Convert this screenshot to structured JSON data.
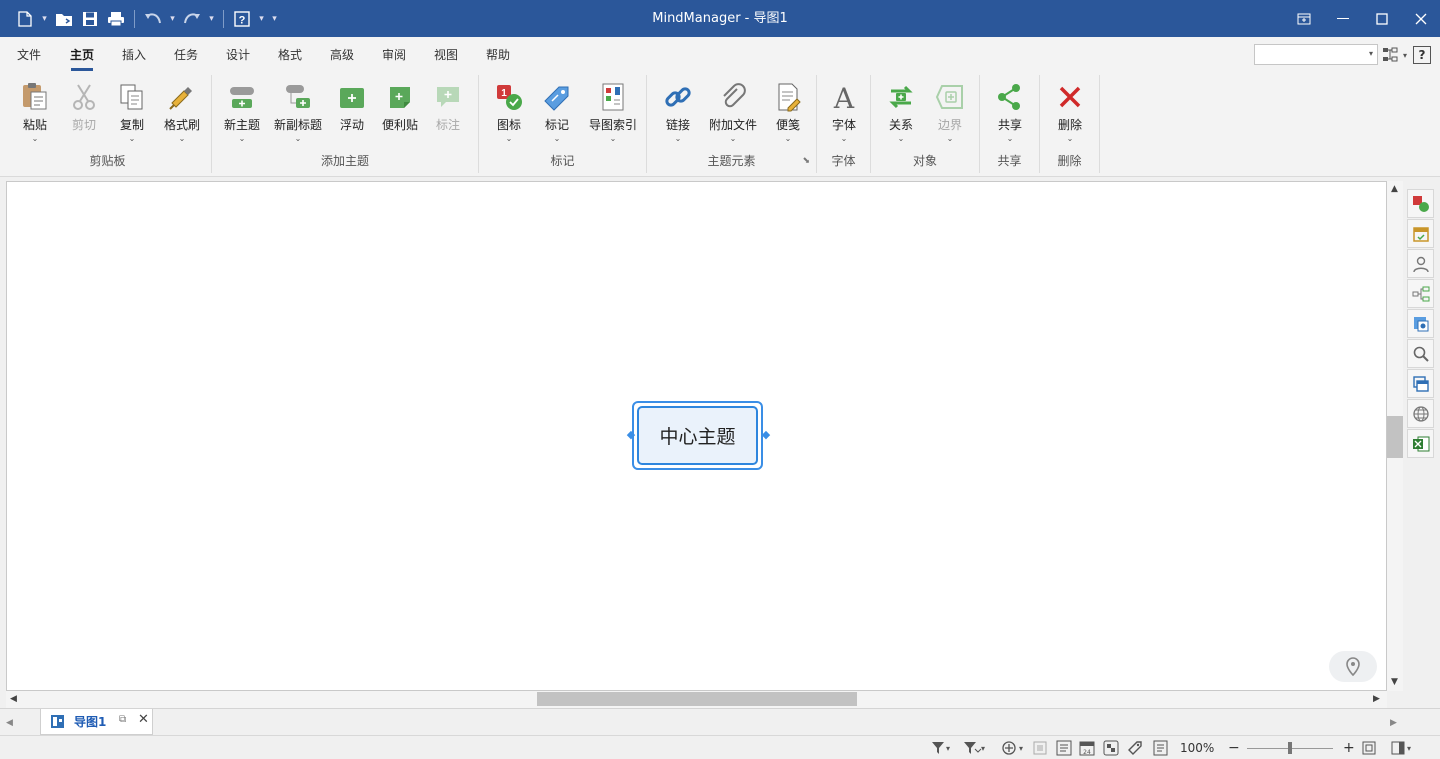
{
  "app": {
    "title": "MindManager - 导图1"
  },
  "qat": {
    "new_icon": "new-document-icon",
    "open_icon": "open-folder-icon",
    "save_icon": "save-icon",
    "print_icon": "print-icon",
    "undo_icon": "undo-icon",
    "redo_icon": "redo-icon",
    "help_icon": "help-icon"
  },
  "tabs": [
    "文件",
    "主页",
    "插入",
    "任务",
    "设计",
    "格式",
    "高级",
    "审阅",
    "视图",
    "帮助"
  ],
  "active_tab": "主页",
  "ribbon": {
    "groups": [
      {
        "label": "剪贴板",
        "buttons": [
          {
            "label": "粘贴",
            "icon": "paste-icon",
            "enabled": true
          },
          {
            "label": "剪切",
            "icon": "cut-icon",
            "enabled": false
          },
          {
            "label": "复制",
            "icon": "copy-icon",
            "enabled": true
          },
          {
            "label": "格式刷",
            "icon": "format-painter-icon",
            "enabled": true
          }
        ]
      },
      {
        "label": "添加主题",
        "buttons": [
          {
            "label": "新主题",
            "icon": "new-topic-icon",
            "enabled": true
          },
          {
            "label": "新副标题",
            "icon": "new-subtopic-icon",
            "enabled": true
          },
          {
            "label": "浮动",
            "icon": "floating-topic-icon",
            "enabled": true
          },
          {
            "label": "便利贴",
            "icon": "sticky-note-icon",
            "enabled": true
          },
          {
            "label": "标注",
            "icon": "callout-icon",
            "enabled": false
          }
        ]
      },
      {
        "label": "标记",
        "buttons": [
          {
            "label": "图标",
            "icon": "icons-icon",
            "enabled": true
          },
          {
            "label": "标记",
            "icon": "tags-icon",
            "enabled": true
          },
          {
            "label": "导图索引",
            "icon": "map-index-icon",
            "enabled": true
          }
        ]
      },
      {
        "label": "主题元素",
        "buttons": [
          {
            "label": "链接",
            "icon": "link-icon",
            "enabled": true
          },
          {
            "label": "附加文件",
            "icon": "attachment-icon",
            "enabled": true
          },
          {
            "label": "便笺",
            "icon": "notes-icon",
            "enabled": true
          }
        ]
      },
      {
        "label": "字体",
        "buttons": [
          {
            "label": "字体",
            "icon": "font-icon",
            "enabled": true
          }
        ]
      },
      {
        "label": "对象",
        "buttons": [
          {
            "label": "关系",
            "icon": "relationship-icon",
            "enabled": true
          },
          {
            "label": "边界",
            "icon": "boundary-icon",
            "enabled": false
          }
        ]
      },
      {
        "label": "共享",
        "buttons": [
          {
            "label": "共享",
            "icon": "share-icon",
            "enabled": true
          }
        ]
      },
      {
        "label": "删除",
        "buttons": [
          {
            "label": "删除",
            "icon": "delete-icon",
            "enabled": true
          }
        ]
      }
    ]
  },
  "canvas": {
    "central_topic": "中心主题"
  },
  "side_panel": [
    "icons-panel-icon",
    "task-panel-icon",
    "resources-panel-icon",
    "map-parts-icon",
    "library-icon",
    "search-icon",
    "browser-icon",
    "web-icon",
    "excel-icon"
  ],
  "doc_tab": {
    "label": "导图1"
  },
  "status": {
    "zoom": "100%"
  },
  "colors": {
    "titlebar": "#2b579a",
    "accent": "#3a8ee6",
    "topic_fill": "#eaf2fb"
  }
}
